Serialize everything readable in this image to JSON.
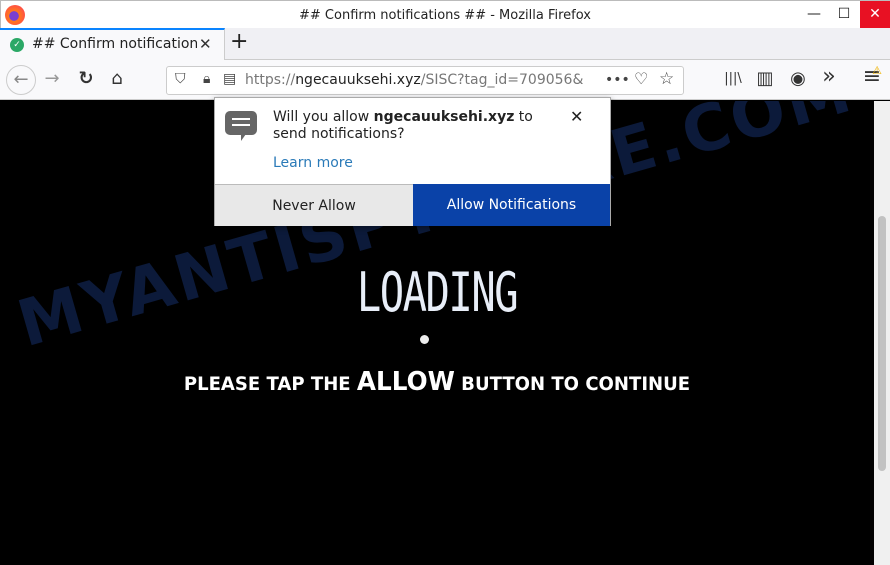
{
  "window": {
    "title": "## Confirm notifications ## - Mozilla Firefox",
    "minimize": "—",
    "maximize": "☐",
    "close": "✕"
  },
  "tab": {
    "title": "## Confirm notifications ##",
    "close": "✕",
    "new_tab": "+"
  },
  "nav": {
    "back": "←",
    "forward": "→",
    "reload": "↻",
    "home": "⌂",
    "url_prefix": "https://",
    "url_domain": "ngecauuksehi.xyz",
    "url_path": "/SISC?tag_id=709056&",
    "more": "•••",
    "pocket": "♡",
    "bookmark": "☆",
    "library": "|||\\",
    "sidebar": "▥",
    "account": "◉",
    "overflow": "»",
    "menu": "≡",
    "warning": "⚠"
  },
  "popup": {
    "text_before": "Will you allow ",
    "domain": "ngecauuksehi.xyz",
    "text_after": " to send notifications?",
    "learn_more": "Learn more",
    "close": "✕",
    "never_allow": "Never Allow",
    "allow": "Allow Notifications"
  },
  "page": {
    "loading": "LOADING",
    "msg_before": "PLEASE TAP THE ",
    "msg_allow": "ALLOW",
    "msg_after": " BUTTON TO CONTINUE",
    "watermark": "MYANTISPYWARE.COM"
  }
}
